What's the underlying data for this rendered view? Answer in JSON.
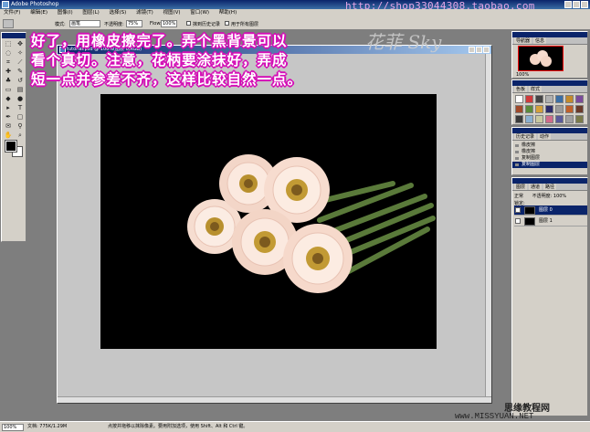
{
  "window": {
    "title": "Adobe Photoshop"
  },
  "watermark_url": "http://shop33044308.taobao.com",
  "menubar": [
    "文件(F)",
    "编辑(E)",
    "图像(I)",
    "图层(L)",
    "选择(S)",
    "滤镜(T)",
    "视图(V)",
    "窗口(W)",
    "帮助(H)"
  ],
  "options": {
    "mode_label": "模式:",
    "mode_value": "画笔",
    "opacity_label": "不透明度:",
    "opacity_value": "75%",
    "flow_label": "Flow:",
    "flow_value": "100%",
    "erase_history": "抹到历史记录",
    "all_layers": "用于所有图层"
  },
  "document": {
    "title": "tutorial.psd @ 100%(图层 0,RGB)"
  },
  "annotation": {
    "line1": "好了，用橡皮擦完了。弄个黑背景可以",
    "line2": "看个真切。注意，花柄要涂抹好，弄成",
    "line3": "短一点并参差不齐，这样比较自然一点。"
  },
  "brand_text": "花菲 Sky",
  "panels": {
    "navigator": {
      "tabs": [
        "导航器",
        "信息"
      ],
      "zoom": "100%"
    },
    "swatches": {
      "tabs": [
        "色板",
        "样式"
      ]
    },
    "history": {
      "tabs": [
        "历史记录",
        "动作"
      ],
      "items": [
        "橡皮擦",
        "橡皮擦",
        "复制图层",
        "复制图层"
      ],
      "selected": 3
    },
    "layers": {
      "tabs": [
        "图层",
        "通道",
        "路径"
      ],
      "mode": "正常",
      "opacity": "不透明度: 100%",
      "lock": "锁定:",
      "items": [
        "图层 0",
        "图层 1"
      ]
    }
  },
  "status": {
    "zoom": "100%",
    "doc_size": "文档: 775K/1.29M",
    "hint": "点按并拖移以抹除像素。要用附加选项，使用 Shift、Alt 和 Ctrl 键。"
  },
  "corner_text": {
    "line1": "思缘教程网",
    "line2": "www.MISSYUAN.NET"
  },
  "colors": {
    "accent": "#0a246a",
    "annotation_outline": "#d40fb6",
    "canvas_bg": "#000000"
  }
}
